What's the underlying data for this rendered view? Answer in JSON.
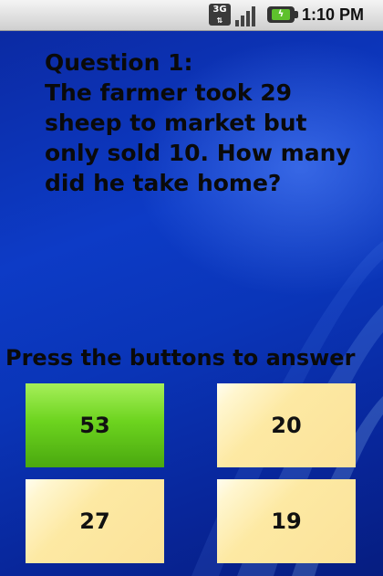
{
  "status_bar": {
    "network": "3G",
    "time": "1:10 PM"
  },
  "question": {
    "title": "Question 1:",
    "text": "The farmer took 29 sheep to market but only sold 10. How many did he take home?"
  },
  "instruction": "Press the buttons to answer",
  "answers": [
    {
      "label": "53",
      "selected": true
    },
    {
      "label": "20",
      "selected": false
    },
    {
      "label": "27",
      "selected": false
    },
    {
      "label": "19",
      "selected": false
    }
  ],
  "colors": {
    "background": "#0b2aa3",
    "answer_button": "#fbe29a",
    "answer_selected": "#6dd41f"
  }
}
